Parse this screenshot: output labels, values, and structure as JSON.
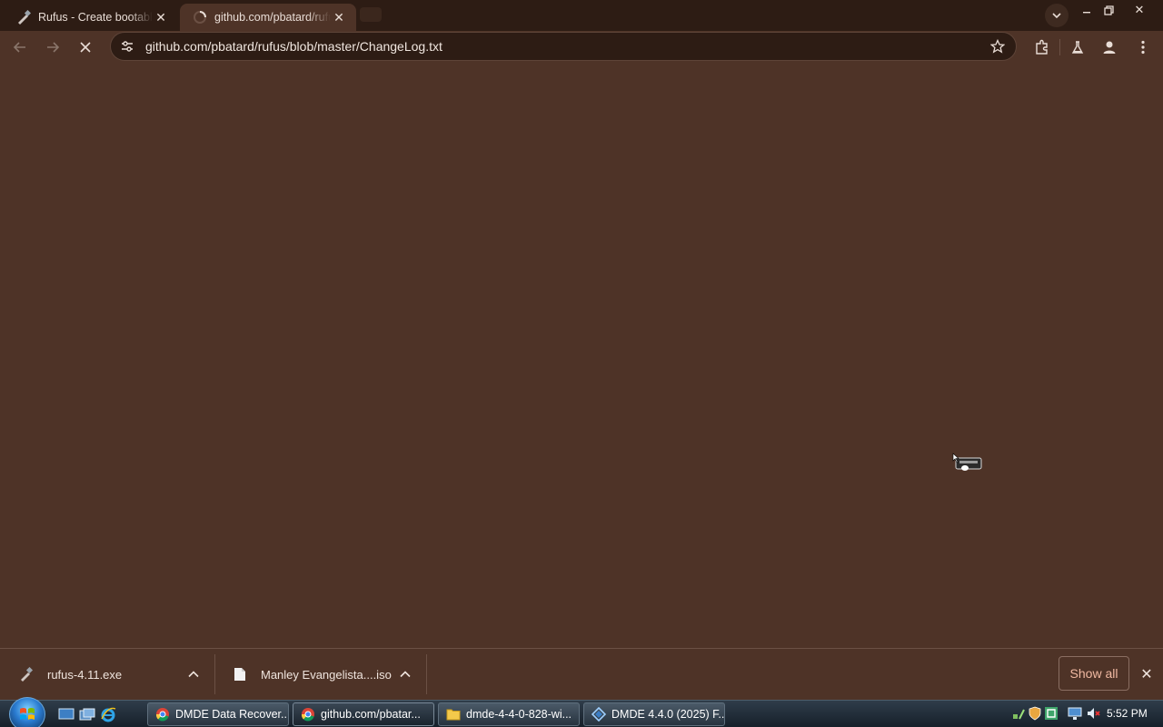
{
  "browser": {
    "tabs": [
      {
        "title": "Rufus - Create bootable USB drives the easy way",
        "active": false
      },
      {
        "title": "github.com/pbatard/rufus/blob/master/ChangeLog.txt",
        "active": true
      }
    ],
    "address": "github.com/pbatard/rufus/blob/master/ChangeLog.txt",
    "icons": {
      "back": "arrow-left-icon",
      "forward": "arrow-right-icon",
      "stop": "close-icon",
      "site_info": "tune-icon",
      "bookmark": "star-icon",
      "extensions": "puzzle-icon",
      "labs": "flask-icon",
      "profile": "person-icon",
      "menu": "kebab-menu-icon"
    },
    "colors": {
      "frame": "#2d1c14",
      "toolbar": "#4e3327",
      "accent": "#f0b9a2"
    }
  },
  "downloads": {
    "items": [
      {
        "name": "rufus-4.11.exe"
      },
      {
        "name": "Manley Evangelista....iso"
      }
    ],
    "show_all": "Show all"
  },
  "taskbar": {
    "tasks": [
      {
        "label": "DMDE Data Recover..."
      },
      {
        "label": "github.com/pbatar..."
      },
      {
        "label": "dmde-4-4-0-828-wi..."
      },
      {
        "label": "DMDE 4.4.0 (2025) F..."
      }
    ],
    "clock": "5:52 PM"
  }
}
